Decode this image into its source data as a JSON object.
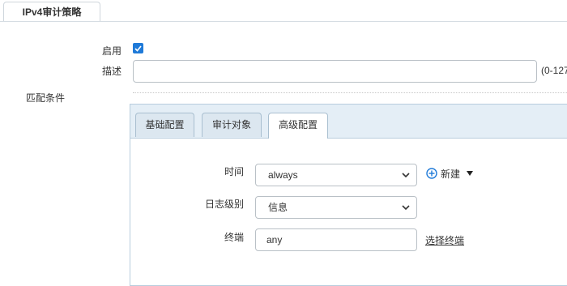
{
  "top_tab": {
    "label": "IPv4审计策略"
  },
  "form": {
    "enable_label": "启用",
    "enabled": true,
    "description_label": "描述",
    "description_value": "",
    "description_hint": "(0-127",
    "match_label": "匹配条件"
  },
  "panel": {
    "tabs": [
      {
        "label": "基础配置"
      },
      {
        "label": "审计对象"
      },
      {
        "label": "高级配置",
        "active": true
      }
    ],
    "fields": {
      "time_label": "时间",
      "time_value": "always",
      "new_label": "新建",
      "log_level_label": "日志级别",
      "log_level_value": "信息",
      "terminal_label": "终端",
      "terminal_value": "any",
      "select_terminal_link": "选择终端"
    }
  },
  "colors": {
    "accent": "#1f7ad8",
    "tab_bg": "#dce7f0",
    "panel_head_bg": "#e4eef6"
  },
  "icons": [
    "checkmark-icon",
    "chevron-down-icon",
    "plus-circle-icon",
    "caret-down-icon"
  ]
}
